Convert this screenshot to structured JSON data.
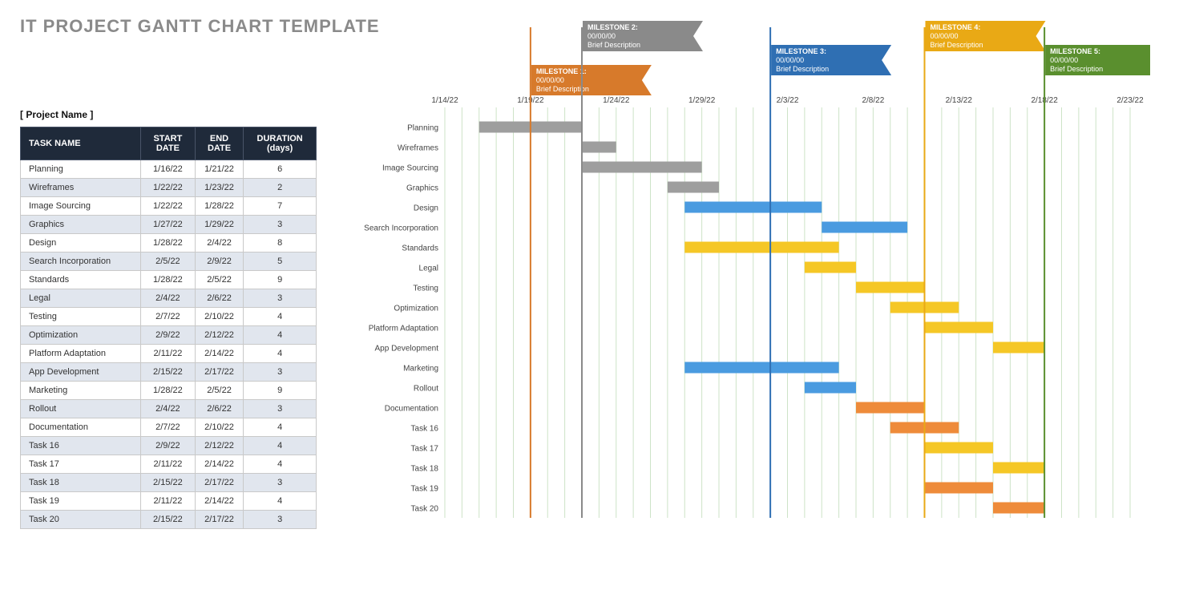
{
  "title": "IT PROJECT GANTT CHART TEMPLATE",
  "project_name_label": "[ Project Name ]",
  "table": {
    "headers": [
      "TASK NAME",
      "START DATE",
      "END DATE",
      "DURATION (days)"
    ]
  },
  "chart_data": {
    "type": "bar",
    "xlabel": "",
    "ylabel": "",
    "x_start": "1/14/22",
    "x_end": "2/23/22",
    "x_ticks": [
      "1/14/22",
      "1/19/22",
      "1/24/22",
      "1/29/22",
      "2/3/22",
      "2/8/22",
      "2/13/22",
      "2/18/22",
      "2/23/22"
    ],
    "milestones": [
      {
        "name": "MILESTONE 1:",
        "date": "00/00/00",
        "desc": "Brief Description",
        "x": "1/19/22",
        "color": "#d77a2b",
        "flag_color": "#d77a2b"
      },
      {
        "name": "MILESTONE 2:",
        "date": "00/00/00",
        "desc": "Brief Description",
        "x": "1/22/22",
        "color": "#8a8a8a",
        "flag_color": "#8a8a8a"
      },
      {
        "name": "MILESTONE 3:",
        "date": "00/00/00",
        "desc": "Brief Description",
        "x": "2/2/22",
        "color": "#2f6fb3",
        "flag_color": "#2f6fb3"
      },
      {
        "name": "MILESTONE 4:",
        "date": "00/00/00",
        "desc": "Brief Description",
        "x": "2/11/22",
        "color": "#e9a915",
        "flag_color": "#e9a915"
      },
      {
        "name": "MILESTONE 5:",
        "date": "00/00/00",
        "desc": "Brief Description",
        "x": "2/18/22",
        "color": "#5a8f2e",
        "flag_color": "#5a8f2e"
      }
    ],
    "tasks": [
      {
        "name": "Planning",
        "start": "1/16/22",
        "end": "1/21/22",
        "duration": 6,
        "color": "#9E9E9E"
      },
      {
        "name": "Wireframes",
        "start": "1/22/22",
        "end": "1/23/22",
        "duration": 2,
        "color": "#9E9E9E"
      },
      {
        "name": "Image Sourcing",
        "start": "1/22/22",
        "end": "1/28/22",
        "duration": 7,
        "color": "#9E9E9E"
      },
      {
        "name": "Graphics",
        "start": "1/27/22",
        "end": "1/29/22",
        "duration": 3,
        "color": "#9E9E9E"
      },
      {
        "name": "Design",
        "start": "1/28/22",
        "end": "2/4/22",
        "duration": 8,
        "color": "#4A9BE0"
      },
      {
        "name": "Search Incorporation",
        "start": "2/5/22",
        "end": "2/9/22",
        "duration": 5,
        "color": "#4A9BE0"
      },
      {
        "name": "Standards",
        "start": "1/28/22",
        "end": "2/5/22",
        "duration": 9,
        "color": "#F5C726"
      },
      {
        "name": "Legal",
        "start": "2/4/22",
        "end": "2/6/22",
        "duration": 3,
        "color": "#F5C726"
      },
      {
        "name": "Testing",
        "start": "2/7/22",
        "end": "2/10/22",
        "duration": 4,
        "color": "#F5C726"
      },
      {
        "name": "Optimization",
        "start": "2/9/22",
        "end": "2/12/22",
        "duration": 4,
        "color": "#F5C726"
      },
      {
        "name": "Platform Adaptation",
        "start": "2/11/22",
        "end": "2/14/22",
        "duration": 4,
        "color": "#F5C726"
      },
      {
        "name": "App Development",
        "start": "2/15/22",
        "end": "2/17/22",
        "duration": 3,
        "color": "#F5C726"
      },
      {
        "name": "Marketing",
        "start": "1/28/22",
        "end": "2/5/22",
        "duration": 9,
        "color": "#4A9BE0"
      },
      {
        "name": "Rollout",
        "start": "2/4/22",
        "end": "2/6/22",
        "duration": 3,
        "color": "#4A9BE0"
      },
      {
        "name": "Documentation",
        "start": "2/7/22",
        "end": "2/10/22",
        "duration": 4,
        "color": "#EE8B3A"
      },
      {
        "name": "Task 16",
        "start": "2/9/22",
        "end": "2/12/22",
        "duration": 4,
        "color": "#EE8B3A"
      },
      {
        "name": "Task 17",
        "start": "2/11/22",
        "end": "2/14/22",
        "duration": 4,
        "color": "#F5C726"
      },
      {
        "name": "Task 18",
        "start": "2/15/22",
        "end": "2/17/22",
        "duration": 3,
        "color": "#F5C726"
      },
      {
        "name": "Task 19",
        "start": "2/11/22",
        "end": "2/14/22",
        "duration": 4,
        "color": "#EE8B3A"
      },
      {
        "name": "Task 20",
        "start": "2/15/22",
        "end": "2/17/22",
        "duration": 3,
        "color": "#EE8B3A"
      }
    ]
  }
}
